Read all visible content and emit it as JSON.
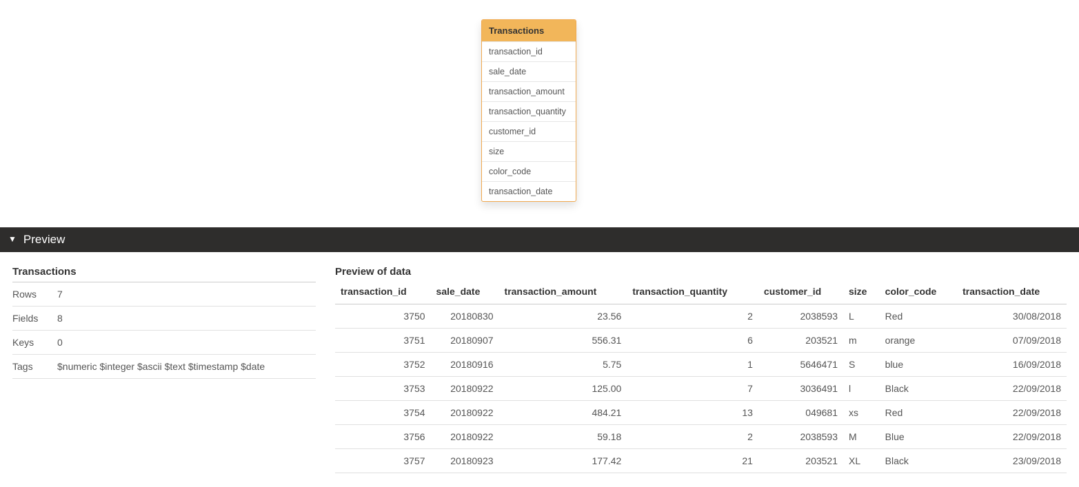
{
  "canvas": {
    "table": {
      "name": "Transactions",
      "fields": [
        "transaction_id",
        "sale_date",
        "transaction_amount",
        "transaction_quantity",
        "customer_id",
        "size",
        "color_code",
        "transaction_date"
      ]
    }
  },
  "preview": {
    "header_label": "Preview",
    "meta": {
      "title": "Transactions",
      "rows_label": "Rows",
      "rows_value": "7",
      "fields_label": "Fields",
      "fields_value": "8",
      "keys_label": "Keys",
      "keys_value": "0",
      "tags_label": "Tags",
      "tags_value": "$numeric $integer $ascii $text $timestamp $date"
    },
    "data": {
      "title": "Preview of data",
      "columns": [
        {
          "name": "transaction_id",
          "align": "num"
        },
        {
          "name": "sale_date",
          "align": "num"
        },
        {
          "name": "transaction_amount",
          "align": "num"
        },
        {
          "name": "transaction_quantity",
          "align": "num"
        },
        {
          "name": "customer_id",
          "align": "num"
        },
        {
          "name": "size",
          "align": "txt"
        },
        {
          "name": "color_code",
          "align": "txt"
        },
        {
          "name": "transaction_date",
          "align": "num"
        }
      ],
      "rows": [
        [
          "3750",
          "20180830",
          "23.56",
          "2",
          "2038593",
          "L",
          "Red",
          "30/08/2018"
        ],
        [
          "3751",
          "20180907",
          "556.31",
          "6",
          "203521",
          "m",
          "orange",
          "07/09/2018"
        ],
        [
          "3752",
          "20180916",
          "5.75",
          "1",
          "5646471",
          "S",
          "blue",
          "16/09/2018"
        ],
        [
          "3753",
          "20180922",
          "125.00",
          "7",
          "3036491",
          "l",
          "Black",
          "22/09/2018"
        ],
        [
          "3754",
          "20180922",
          "484.21",
          "13",
          "049681",
          "xs",
          "Red",
          "22/09/2018"
        ],
        [
          "3756",
          "20180922",
          "59.18",
          "2",
          "2038593",
          "M",
          "Blue",
          "22/09/2018"
        ],
        [
          "3757",
          "20180923",
          "177.42",
          "21",
          "203521",
          "XL",
          "Black",
          "23/09/2018"
        ]
      ]
    }
  }
}
